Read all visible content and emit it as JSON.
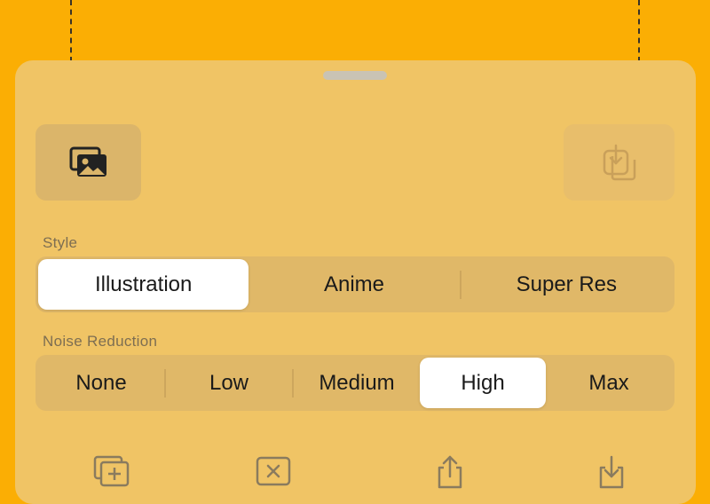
{
  "sheet": {
    "style": {
      "label": "Style",
      "options": [
        "Illustration",
        "Anime",
        "Super Res"
      ],
      "selected": "Illustration"
    },
    "noise_reduction": {
      "label": "Noise Reduction",
      "options": [
        "None",
        "Low",
        "Medium",
        "High",
        "Max"
      ],
      "selected": "High"
    },
    "icons": {
      "photos": "photo-library-icon",
      "save": "save-to-device-icon",
      "bottom": [
        "add-images-icon",
        "clear-icon",
        "share-icon",
        "download-icon"
      ]
    }
  },
  "colors": {
    "background": "#FBAE04",
    "sheet": "#F0C465",
    "segment_track": "#E0B868",
    "selected_segment": "#FFFFFF"
  }
}
